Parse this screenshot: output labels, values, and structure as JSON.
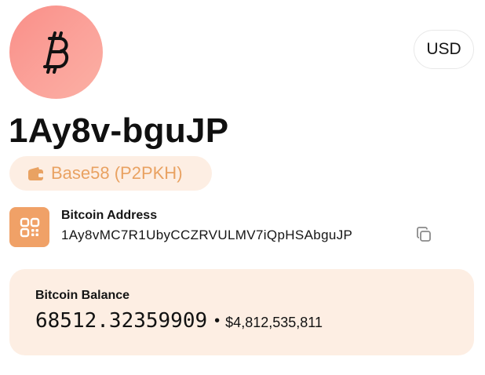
{
  "header": {
    "coin_icon": "bitcoin-symbol-icon",
    "currency_button": "USD"
  },
  "address": {
    "short": "1Ay8v-bguJP",
    "type_icon": "wallet-icon",
    "type_label": "Base58 (P2PKH)",
    "section_icon": "qr-code-icon",
    "title": "Bitcoin Address",
    "full": "1Ay8vMC7R1UbyCCZRVULMV7iQpHSAbguJP",
    "copy_icon": "copy-icon"
  },
  "balance": {
    "title": "Bitcoin Balance",
    "btc": "68512.32359909",
    "separator": "•",
    "usd": "$4,812,535,811"
  },
  "colors": {
    "accent": "#f0a167",
    "badge_bg": "#fdeee3",
    "badge_text": "#e9a262",
    "avatar_gradient_start": "#f98f88",
    "avatar_gradient_end": "#fbb0a4"
  }
}
